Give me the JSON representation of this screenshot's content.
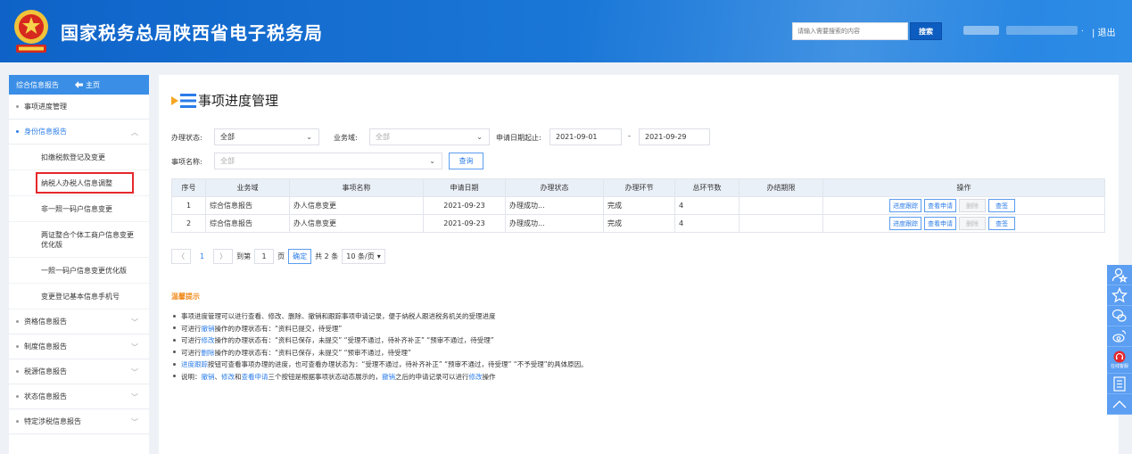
{
  "header": {
    "title": "国家税务总局陕西省电子税务局",
    "search_placeholder": "请输入需要搜索的内容",
    "search_button": "搜索",
    "separator": ".",
    "logout": "| 退出"
  },
  "sidebar": {
    "head_label": "综合信息报告",
    "home_label": "主页",
    "items": [
      {
        "label": "事项进度管理"
      },
      {
        "label": "身份信息报告",
        "expanded": true
      },
      {
        "label": "资格信息报告"
      },
      {
        "label": "制度信息报告"
      },
      {
        "label": "税源信息报告"
      },
      {
        "label": "状态信息报告"
      },
      {
        "label": "特定涉税信息报告"
      }
    ],
    "subitems": [
      "扣缴税款登记及变更",
      "纳税人办税人信息调整",
      "非一照一码户信息变更",
      "两证整合个体工商户信息变更优化版",
      "一照一码户信息变更优化版",
      "变更登记基本信息手机号"
    ]
  },
  "page": {
    "title": "事项进度管理"
  },
  "filters": {
    "status_label": "办理状态:",
    "status_value": "全部",
    "domain_label": "业务域:",
    "domain_value": "全部",
    "date_label": "申请日期起止:",
    "date_from": "2021-09-01",
    "date_sep": "-",
    "date_to": "2021-09-29",
    "name_label": "事项名称:",
    "name_value": "全部",
    "query_button": "查询"
  },
  "table": {
    "headers": [
      "序号",
      "业务域",
      "事项名称",
      "申请日期",
      "办理状态",
      "办理环节",
      "总环节数",
      "办结期限",
      "操作"
    ],
    "rows": [
      {
        "no": "1",
        "domain": "综合信息报告",
        "name": "办人信息变更",
        "date": "2021-09-23",
        "status": "办理成功...",
        "stage": "完成",
        "total": "4",
        "deadline": ""
      },
      {
        "no": "2",
        "domain": "综合信息报告",
        "name": "办人信息变更",
        "date": "2021-09-23",
        "status": "办理成功...",
        "stage": "完成",
        "total": "4",
        "deadline": ""
      }
    ],
    "ops": {
      "track": "进度跟踪",
      "view": "查看申请",
      "delete": "删除",
      "sign": "查签"
    }
  },
  "pager": {
    "page": "1",
    "goto_label": "到第",
    "goto_value": "1",
    "page_unit": "页",
    "ok": "确定",
    "total": "共 2 条",
    "size": "10 条/页"
  },
  "tips": {
    "title": "温馨提示",
    "lines": {
      "l1": "事项进度管理可以进行查看、修改、删除、撤销和跟踪事项申请记录，便于纳税人跟进税务机关的受理进度",
      "l2a": "可进行",
      "l2b": "撤销",
      "l2c": "操作的办理状态有：“资料已提交，待受理”",
      "l3a": "可进行",
      "l3b": "修改",
      "l3c": "操作的办理状态有：“资料已保存，未提交”  “受理不通过，待补齐补正”  “预审不通过，待受理”",
      "l4a": "可进行",
      "l4b": "删除",
      "l4c": "操作的办理状态有：“资料已保存，未提交”  “预审不通过，待受理”",
      "l5a": "进度跟踪",
      "l5b": "按钮可查看事项办理的进度，也可查看办理状态为：“受理不通过，待补齐补正”  “预审不通过，待受理”  “不予受理”的具体原因。",
      "l6a": "说明：",
      "l6b": "撤销",
      "l6c": "、",
      "l6d": "修改",
      "l6e": "和",
      "l6f": "查看申请",
      "l6g": "三个按钮是根据事项状态动态展示的，",
      "l6h": "撤销",
      "l6i": "之后的申请记录可以进行",
      "l6j": "修改",
      "l6k": "操作"
    }
  },
  "float_bar": {
    "service_label": "在线客服"
  }
}
